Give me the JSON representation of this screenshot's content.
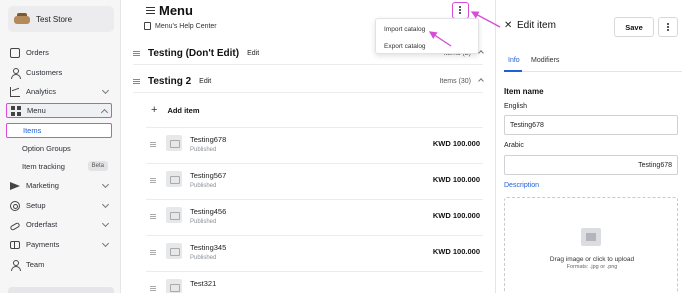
{
  "sidebar": {
    "store_name": "Test Store",
    "items": [
      {
        "label": "Orders",
        "icon": "box-icon"
      },
      {
        "label": "Customers",
        "icon": "customers-icon"
      },
      {
        "label": "Analytics",
        "icon": "analytics-icon"
      },
      {
        "label": "Menu",
        "icon": "menu-grid-icon"
      },
      {
        "label": "Marketing",
        "icon": "send-icon"
      },
      {
        "label": "Setup",
        "icon": "gear-icon"
      },
      {
        "label": "Orderfast",
        "icon": "link-icon"
      },
      {
        "label": "Payments",
        "icon": "card-icon"
      },
      {
        "label": "Team",
        "icon": "person-icon"
      }
    ],
    "sub_items": [
      {
        "label": "Items"
      },
      {
        "label": "Option Groups"
      },
      {
        "label": "Item tracking",
        "badge": "Beta"
      }
    ]
  },
  "main": {
    "title": "Menu",
    "help_link": "Menu's Help Center",
    "dropdown": {
      "items": [
        "Import catalog",
        "Export catalog"
      ]
    },
    "sections": [
      {
        "title": "Testing (Don't Edit)",
        "edit_label": "Edit",
        "count": "Items (2)"
      },
      {
        "title": "Testing 2",
        "edit_label": "Edit",
        "count": "Items (30)"
      }
    ],
    "add_item_label": "Add item",
    "items": [
      {
        "name": "Testing678",
        "status": "Published",
        "price": "KWD 100.000"
      },
      {
        "name": "Testing567",
        "status": "Published",
        "price": "KWD 100.000"
      },
      {
        "name": "Testing456",
        "status": "Published",
        "price": "KWD 100.000"
      },
      {
        "name": "Testing345",
        "status": "Published",
        "price": "KWD 100.000"
      },
      {
        "name": "Test321",
        "status": "",
        "price": ""
      }
    ]
  },
  "panel": {
    "title": "Edit item",
    "save_label": "Save",
    "tabs": [
      "Info",
      "Modifiers"
    ],
    "heading": "Item name",
    "english_label": "English",
    "english_value": "Testing678",
    "arabic_label": "Arabic",
    "arabic_value": "Testing678",
    "description_label": "Description",
    "upload_text": "Drag image or click to upload",
    "upload_formats": "Formats: .jpg or .png"
  },
  "colors": {
    "accent": "#1f5fd9",
    "highlight": "#d64dd6"
  }
}
